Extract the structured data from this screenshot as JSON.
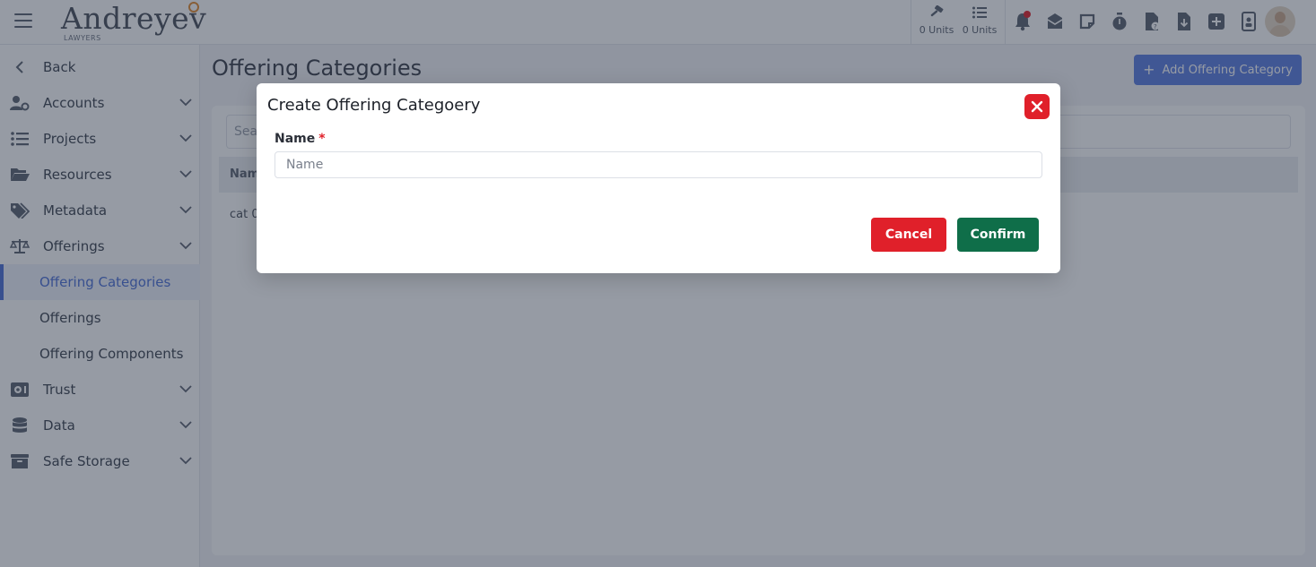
{
  "app": {
    "logo_name": "Andreyev",
    "logo_sub": "LAWYERS"
  },
  "header": {
    "units": [
      {
        "icon": "gavel-icon",
        "label": "0 Units"
      },
      {
        "icon": "list-icon",
        "label": "0 Units"
      }
    ],
    "icons": [
      "bell-icon",
      "inbox-icon",
      "note-icon",
      "timer-icon",
      "document-question-icon",
      "document-download-icon",
      "plus-square-icon",
      "id-badge-icon"
    ]
  },
  "sidebar": {
    "back_label": "Back",
    "items": [
      {
        "label": "Accounts",
        "icon": "users-cog-icon"
      },
      {
        "label": "Projects",
        "icon": "list-icon"
      },
      {
        "label": "Resources",
        "icon": "folder-open-icon"
      },
      {
        "label": "Metadata",
        "icon": "tags-icon"
      },
      {
        "label": "Offerings",
        "icon": "balance-scale-icon"
      }
    ],
    "sub_items": [
      {
        "label": "Offering Categories",
        "active": true
      },
      {
        "label": "Offerings"
      },
      {
        "label": "Offering Components"
      }
    ],
    "items_bottom": [
      {
        "label": "Trust",
        "icon": "vault-icon"
      },
      {
        "label": "Data",
        "icon": "database-icon"
      },
      {
        "label": "Safe Storage",
        "icon": "archive-icon"
      }
    ]
  },
  "main": {
    "title": "Offering Categories",
    "add_button": "Add Offering Category",
    "search_placeholder": "Sea",
    "table": {
      "header_name": "Nam",
      "row_first_cell": "cat 0"
    }
  },
  "modal": {
    "title": "Create Offering Categoery",
    "name_label": "Name",
    "required_mark": "*",
    "name_placeholder": "Name",
    "name_value": "",
    "cancel_label": "Cancel",
    "confirm_label": "Confirm"
  },
  "colors": {
    "accent": "#5b7de0",
    "danger": "#e0202a",
    "confirm": "#0f6e49"
  }
}
